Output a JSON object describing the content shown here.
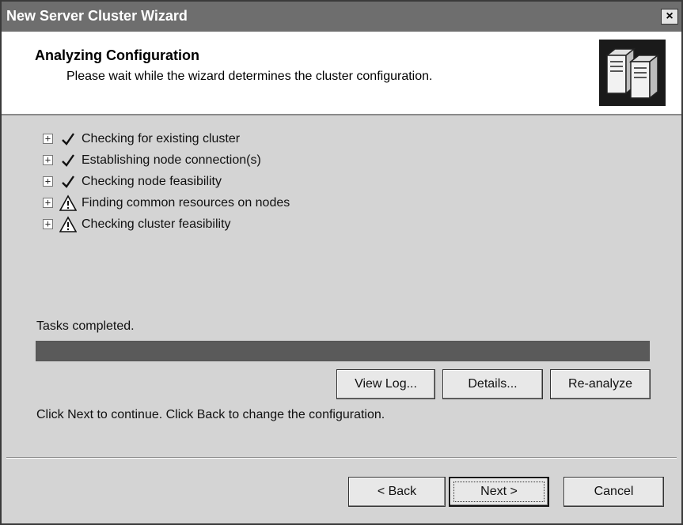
{
  "window": {
    "title": "New Server Cluster Wizard",
    "close_symbol": "×"
  },
  "header": {
    "title": "Analyzing Configuration",
    "subtitle": "Please wait while the wizard determines the cluster configuration.",
    "icon": "server-cluster-icon"
  },
  "tasks": [
    {
      "label": "Checking for existing cluster",
      "status": "check"
    },
    {
      "label": "Establishing node connection(s)",
      "status": "check"
    },
    {
      "label": "Checking node feasibility",
      "status": "check"
    },
    {
      "label": "Finding common resources on nodes",
      "status": "warning"
    },
    {
      "label": "Checking cluster feasibility",
      "status": "warning"
    }
  ],
  "expander_symbol": "+",
  "progress": {
    "label": "Tasks completed.",
    "percent": 100
  },
  "buttons": {
    "view_log": "View Log...",
    "details": "Details...",
    "reanalyze": "Re-analyze",
    "back": "< Back",
    "next": "Next >",
    "cancel": "Cancel"
  },
  "instructions": "Click Next to continue. Click Back to change the configuration.",
  "colors": {
    "titlebar": "#6e6e6e",
    "dialog_bg": "#d4d4d4",
    "progress_fill": "#5a5a5a"
  }
}
